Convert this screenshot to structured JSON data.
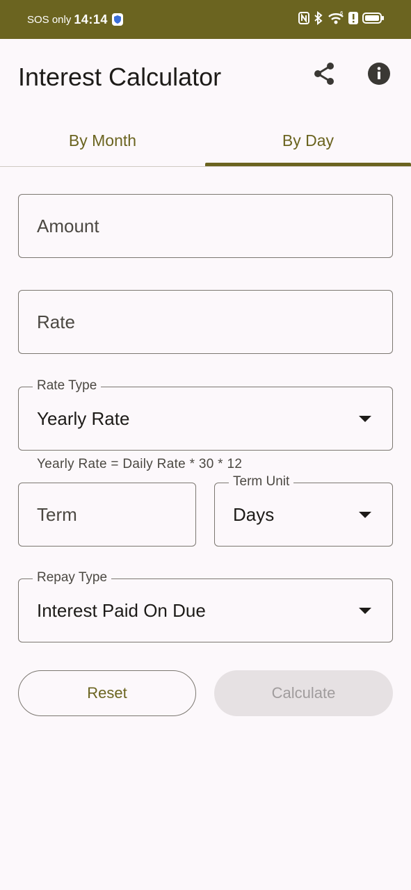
{
  "status_bar": {
    "carrier": "SOS only",
    "time": "14:14",
    "signal_badge": "6",
    "icons": [
      "shield-icon",
      "nfc-icon",
      "bluetooth-icon",
      "wifi-icon",
      "alert-icon",
      "battery-icon"
    ]
  },
  "app_bar": {
    "title": "Interest Calculator",
    "actions": [
      "share-icon",
      "info-icon"
    ]
  },
  "tabs": [
    {
      "label": "By Month",
      "selected": false
    },
    {
      "label": "By Day",
      "selected": true
    }
  ],
  "form": {
    "amount": {
      "placeholder": "Amount",
      "value": ""
    },
    "rate": {
      "placeholder": "Rate",
      "value": ""
    },
    "rate_type": {
      "label": "Rate Type",
      "value": "Yearly Rate"
    },
    "rate_helper": "Yearly Rate = Daily Rate * 30 * 12",
    "term": {
      "placeholder": "Term",
      "value": ""
    },
    "term_unit": {
      "label": "Term Unit",
      "value": "Days"
    },
    "repay_type": {
      "label": "Repay Type",
      "value": "Interest Paid On Due"
    }
  },
  "buttons": {
    "reset": "Reset",
    "calculate": "Calculate",
    "calculate_enabled": false
  },
  "colors": {
    "primary": "#6b6420",
    "background": "#fcf8fb",
    "outline": "#7b7770",
    "disabled_bg": "#e6e1e3"
  }
}
